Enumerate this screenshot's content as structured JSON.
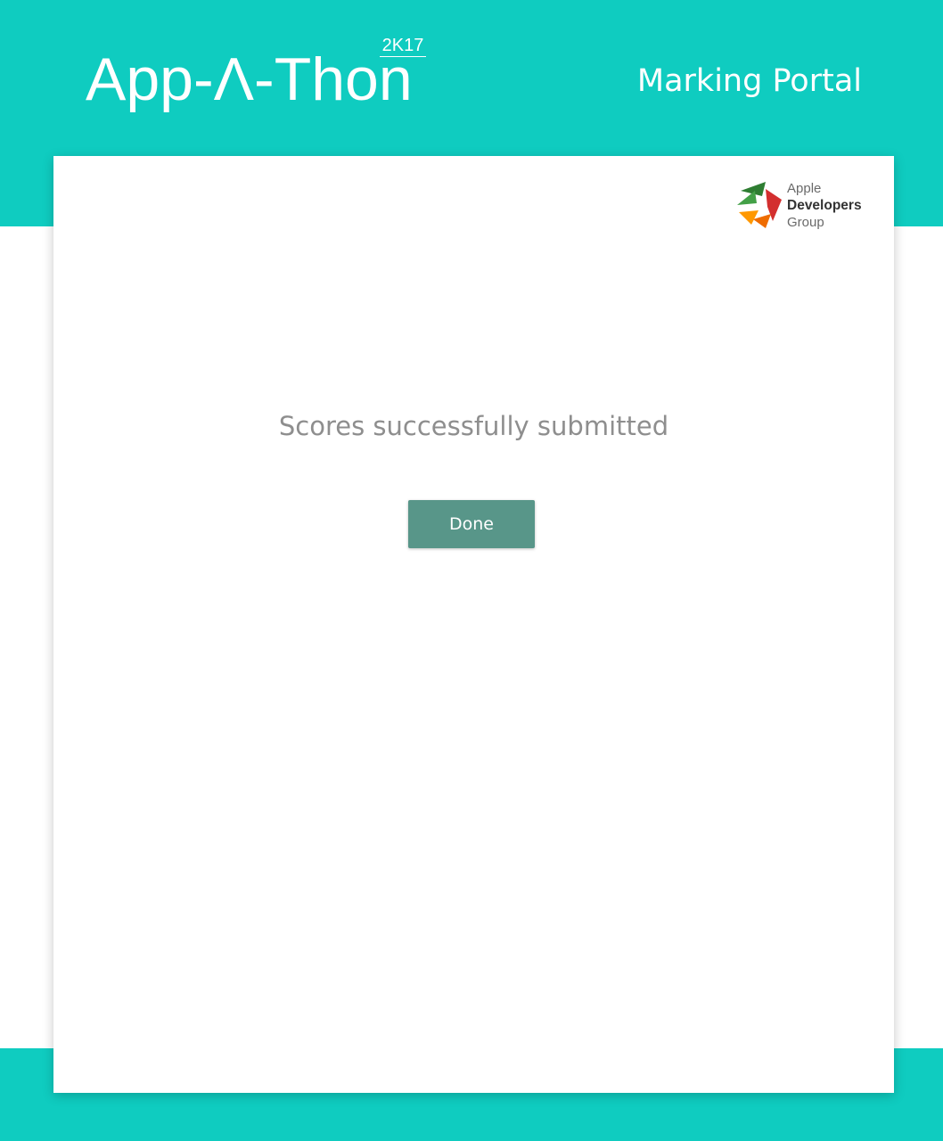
{
  "header": {
    "brand_name": "App-Λ-Thon",
    "brand_year": "2K17",
    "portal_title": "Marking Portal"
  },
  "logo": {
    "line1": "Apple",
    "line2": "Developers",
    "line3": "Group",
    "icon": "apple-developers-group-logo-icon"
  },
  "main": {
    "message": "Scores successfully submitted",
    "done_label": "Done"
  },
  "colors": {
    "header_band": "#0fccc0",
    "button": "#589689",
    "message_text": "#8e8e8e"
  }
}
